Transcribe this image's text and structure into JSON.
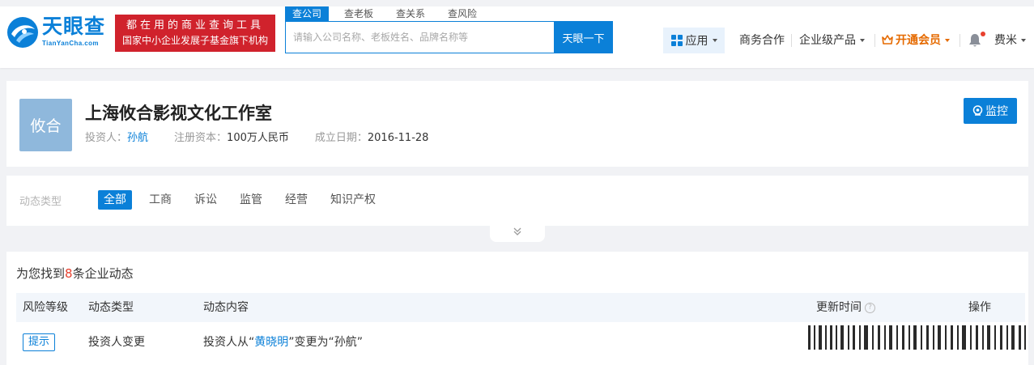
{
  "header": {
    "logo_cn": "天眼查",
    "logo_en": "TianYanCha.com",
    "slogan_line1": "都在用的商业查询工具",
    "slogan_line2": "国家中小企业发展子基金旗下机构",
    "search_tabs": [
      {
        "label": "查公司",
        "active": true
      },
      {
        "label": "查老板",
        "active": false
      },
      {
        "label": "查关系",
        "active": false
      },
      {
        "label": "查风险",
        "active": false
      }
    ],
    "search_placeholder": "请输入公司名称、老板姓名、品牌名称等",
    "search_value": "",
    "search_button": "天眼一下",
    "nav": {
      "apps": "应用",
      "business": "商务合作",
      "enterprise": "企业级产品",
      "vip": "开通会员",
      "username": "费米"
    },
    "colors": {
      "brand": "#0b80d8",
      "slogan_bg": "#d0222c",
      "vip": "#e56a00"
    }
  },
  "company": {
    "logo_text": "攸合",
    "name": "上海攸合影视文化工作室",
    "investor_label": "投资人：",
    "investor": "孙航",
    "capital_label": "注册资本：",
    "capital": "100万人民币",
    "founded_label": "成立日期：",
    "founded": "2016-11-28",
    "monitor_button": "监控"
  },
  "filter": {
    "label": "动态类型",
    "tabs": [
      {
        "label": "全部",
        "active": true
      },
      {
        "label": "工商",
        "active": false
      },
      {
        "label": "诉讼",
        "active": false
      },
      {
        "label": "监管",
        "active": false
      },
      {
        "label": "经营",
        "active": false
      },
      {
        "label": "知识产权",
        "active": false
      }
    ]
  },
  "results": {
    "prefix": "为您找到",
    "count": "8",
    "suffix": "条企业动态",
    "columns": {
      "risk": "风险等级",
      "type": "动态类型",
      "content": "动态内容",
      "time": "更新时间",
      "action": "操作"
    },
    "rows": [
      {
        "risk": "提示",
        "type": "投资人变更",
        "content_prefix": "投资人从“",
        "content_from": "黄晓明",
        "content_mid": "”变更为“",
        "content_to": "孙航",
        "content_suffix": "”"
      }
    ]
  }
}
